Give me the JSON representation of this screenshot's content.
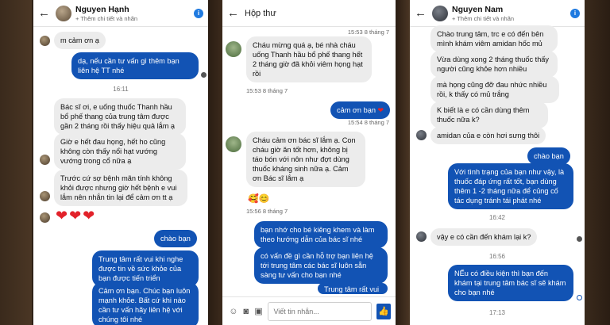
{
  "panel1": {
    "header": {
      "name": "Nguyen Hạnh",
      "sub": "+ Thêm chi tiết và nhãn"
    },
    "msgs": [
      "m cảm ơn ạ",
      "dạ, nếu cần tư vấn gì thêm bạn liên hệ TT nhé",
      "16:11",
      "Bác sĩ ơi, e uống thuốc Thanh hầu bổ phế thang của trung tâm được gần 2 tháng rồi thấy hiệu quả lắm ạ",
      "Giờ e hết đau họng, hết ho cũng không còn thấy nổi hạt vướng vướng trong cổ nữa ạ",
      "Trước cứ sợ bệnh mãn tính không khỏi được nhưng giờ hết bệnh e vui lắm nên nhắn tin lại để cảm ơn tt ạ",
      "❤❤❤",
      "chào bạn",
      "Trung tâm rất vui khi nghe được tin về sức khỏe của bạn được tiến triển",
      "Cảm ơn bạn. Chúc bạn luôn mạnh khỏe. Bất cứ khi nào cần tư vấn hãy liên hệ với chúng tôi nhé"
    ]
  },
  "panel2": {
    "header": {
      "title": "Hộp thư"
    },
    "msgs": [
      "15:53 8 tháng 7",
      "Cháu mừng quá ạ, bé nhà cháu uống Thanh hầu bổ phế thang hết 2 tháng giờ đã khỏi viêm họng hạt rồi",
      "15:53 8 tháng 7",
      "cảm ơn bạn",
      "15:54 8 tháng 7",
      "Cháu cảm ơn bác sĩ lắm ạ. Con cháu giờ ăn tốt hơn, không bị táo bón với nôn như đợt dùng thuốc kháng sinh nữa ạ. Cảm ơn Bác sĩ lắm ạ",
      "🥰😊",
      "15:56 8 tháng 7",
      "bạn nhớ cho bé kiêng khem và làm theo hướng dẫn của bác sĩ nhé",
      "có vấn đề gì cần hỗ trợ bạn liên hệ tới trung tâm các bác sĩ luôn sẵn sàng tư vấn cho bạn nhé",
      "Trung tâm rất vui khi được là địa chỉ..."
    ],
    "composer": {
      "placeholder": "Viết tin nhắn..."
    }
  },
  "panel3": {
    "header": {
      "name": "Nguyen Nam",
      "sub": "+ Thêm chi tiết và nhãn"
    },
    "msgs": [
      "Chào trung tâm, trc e có đến bên mình khám viêm amidan hốc mủ",
      "Vừa dùng xong 2 tháng thuốc thấy người cũng khỏe hơn nhiều",
      "mà họng cũng đỡ đau nhức nhiều rồi, k thấy có mủ trắng",
      "K biết là e có cần dùng thêm thuốc nữa k?",
      "amidan của e còn hơi sưng thôi",
      "chào bạn",
      "Với tình trạng của bạn như vậy, là thuốc đáp ứng rất tốt, bạn dùng thêm 1 -2 tháng nữa để củng cố tác dụng tránh tái phát nhé",
      "16:42",
      "vậy e có cần đến khám lại k?",
      "16:56",
      "NẾu có điều kiện thì bạn đến khám tại trung tâm bác sĩ sẽ khám cho bạn nhé",
      "17:13"
    ]
  }
}
